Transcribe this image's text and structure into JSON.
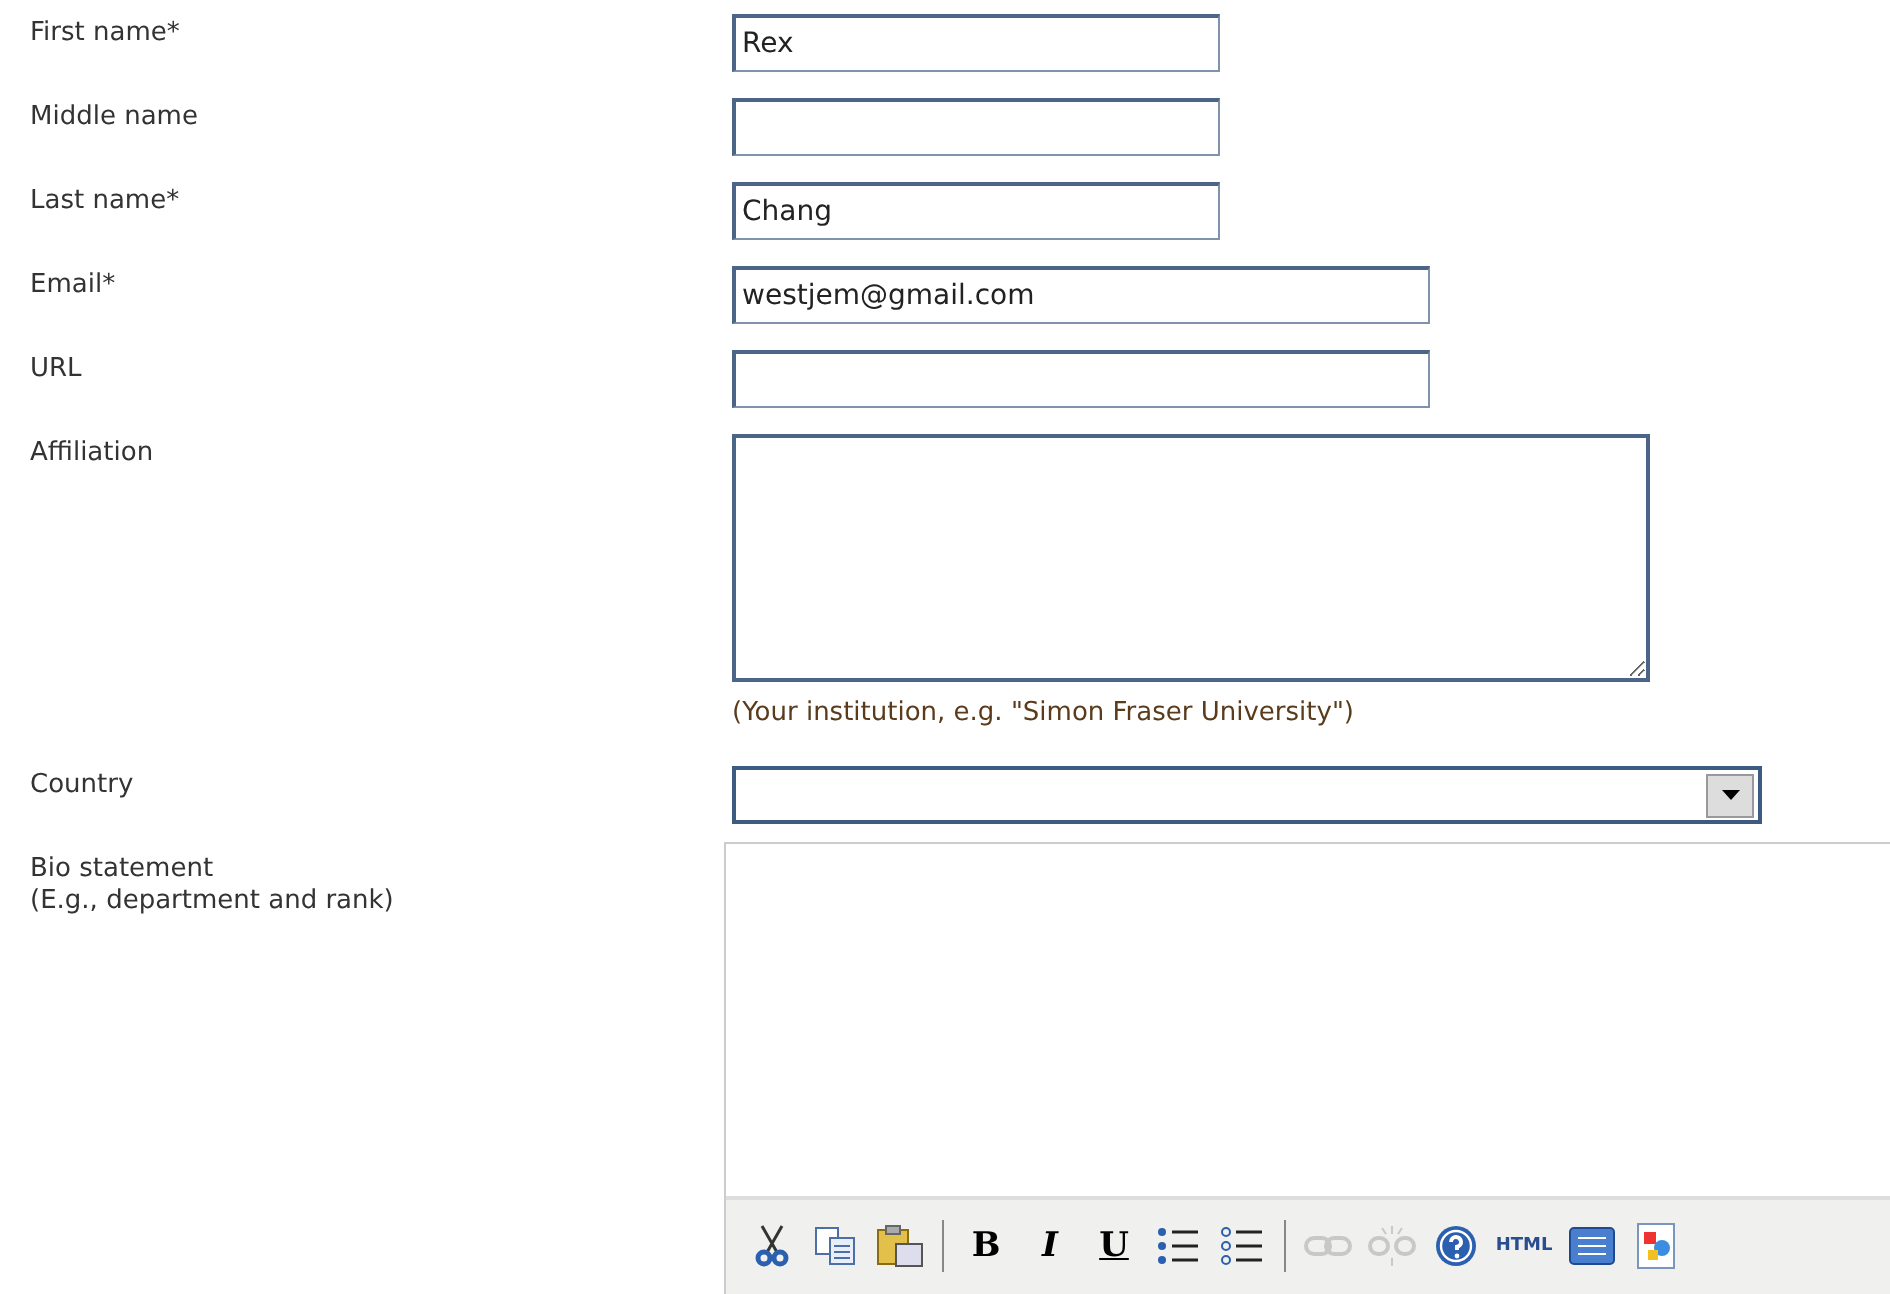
{
  "fields": [
    {
      "kind": "short",
      "label": "First name*",
      "value": "Rex"
    },
    {
      "kind": "short",
      "label": "Middle name"
    },
    {
      "kind": "short",
      "label": "Last name*",
      "value": "Chang"
    },
    {
      "kind": "wide",
      "label": "Email*",
      "value": "westjem@gmail.com"
    },
    {
      "kind": "wide",
      "label": "URL"
    },
    {
      "kind": "textarea",
      "label": "Affiliation",
      "hint": "(Your institution, e.g. \"Simon Fraser University\")"
    },
    {
      "kind": "select",
      "label": "Country"
    },
    {
      "kind": "editor",
      "label": "Bio statement",
      "sublabel": "(E.g., department and rank)",
      "toolbar": [
        {
          "kind": "cut"
        },
        {
          "kind": "copy"
        },
        {
          "kind": "paste"
        },
        {
          "kind": "separator"
        },
        {
          "kind": "bold",
          "text": "B"
        },
        {
          "kind": "italic",
          "text": "I"
        },
        {
          "kind": "underline",
          "text": "U"
        },
        {
          "kind": "bullets"
        },
        {
          "kind": "numbers"
        },
        {
          "kind": "separator"
        },
        {
          "kind": "link",
          "disabled": true
        },
        {
          "kind": "unlink",
          "disabled": true
        },
        {
          "kind": "help"
        },
        {
          "kind": "html",
          "text": "HTML"
        },
        {
          "kind": "window"
        },
        {
          "kind": "image"
        }
      ]
    }
  ]
}
